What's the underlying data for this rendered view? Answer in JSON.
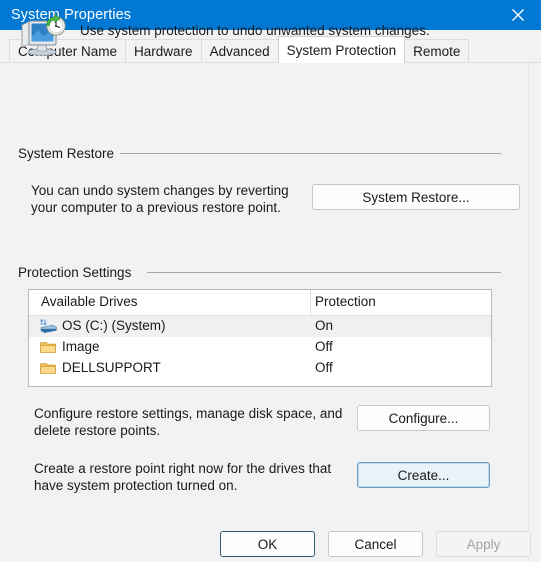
{
  "window": {
    "title": "System Properties",
    "close_icon": "close-icon",
    "titlebar_color": "#0078d4"
  },
  "tabs": [
    {
      "label": "Computer Name",
      "selected": false
    },
    {
      "label": "Hardware",
      "selected": false
    },
    {
      "label": "Advanced",
      "selected": false
    },
    {
      "label": "System Protection",
      "selected": true
    },
    {
      "label": "Remote",
      "selected": false
    }
  ],
  "header": {
    "icon": "system-protection-icon",
    "text": "Use system protection to undo unwanted system changes."
  },
  "system_restore": {
    "group_label": "System Restore",
    "description": "You can undo system changes by reverting your computer to a previous restore point.",
    "button_label": "System Restore..."
  },
  "protection_settings": {
    "group_label": "Protection Settings",
    "columns": [
      "Available Drives",
      "Protection"
    ],
    "rows": [
      {
        "name": "OS (C:) (System)",
        "protection": "On",
        "icon": "hard-drive-icon",
        "selected": true
      },
      {
        "name": "Image",
        "protection": "Off",
        "icon": "folder-icon",
        "selected": false
      },
      {
        "name": "DELLSUPPORT",
        "protection": "Off",
        "icon": "folder-icon",
        "selected": false
      }
    ],
    "configure": {
      "description": "Configure restore settings, manage disk space, and delete restore points.",
      "button_label": "Configure..."
    },
    "create": {
      "description": "Create a restore point right now for the drives that have system protection turned on.",
      "button_label": "Create..."
    }
  },
  "footer": {
    "ok_label": "OK",
    "cancel_label": "Cancel",
    "apply_label": "Apply",
    "apply_disabled": true
  }
}
